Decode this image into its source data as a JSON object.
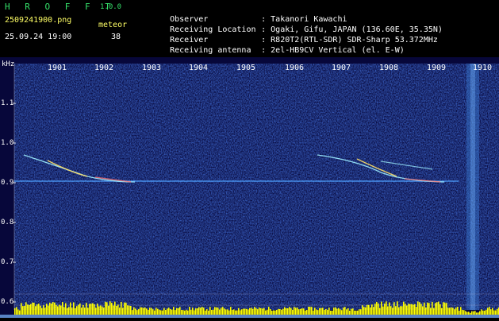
{
  "header": {
    "app_title": "H R O F F T",
    "app_version": "1.0.0",
    "filename": "2509241900.png",
    "datetime": "25.09.24 19:00",
    "meteor_label": "meteor",
    "meteor_count": "38",
    "info": [
      {
        "label": "Observer",
        "value": ": Takanori Kawachi"
      },
      {
        "label": "Receiving Location",
        "value": ": Ogaki, Gifu, JAPAN (136.60E, 35.35N)"
      },
      {
        "label": "Receiver",
        "value": ": R820T2(RTL-SDR) SDR-Sharp 53.372MHz"
      },
      {
        "label": "Receiving antenna",
        "value": ": 2el-HB9CV Vertical (el. E-W)"
      }
    ]
  },
  "spectrogram": {
    "unit_label": "kHz",
    "time_ticks": [
      "1901",
      "1902",
      "1903",
      "1904",
      "1905",
      "1906",
      "1907",
      "1908",
      "1909",
      "1910"
    ],
    "freq_ticks": [
      "1.1",
      "1.0",
      "0.9",
      "0.8",
      "0.7",
      "0.6"
    ],
    "colors": {
      "background": "#0a0a4a",
      "carrier": "#4fa0ff",
      "echo": "#ffe066",
      "amplitude": "#ffff00",
      "grid": "#6a6aa0"
    }
  }
}
